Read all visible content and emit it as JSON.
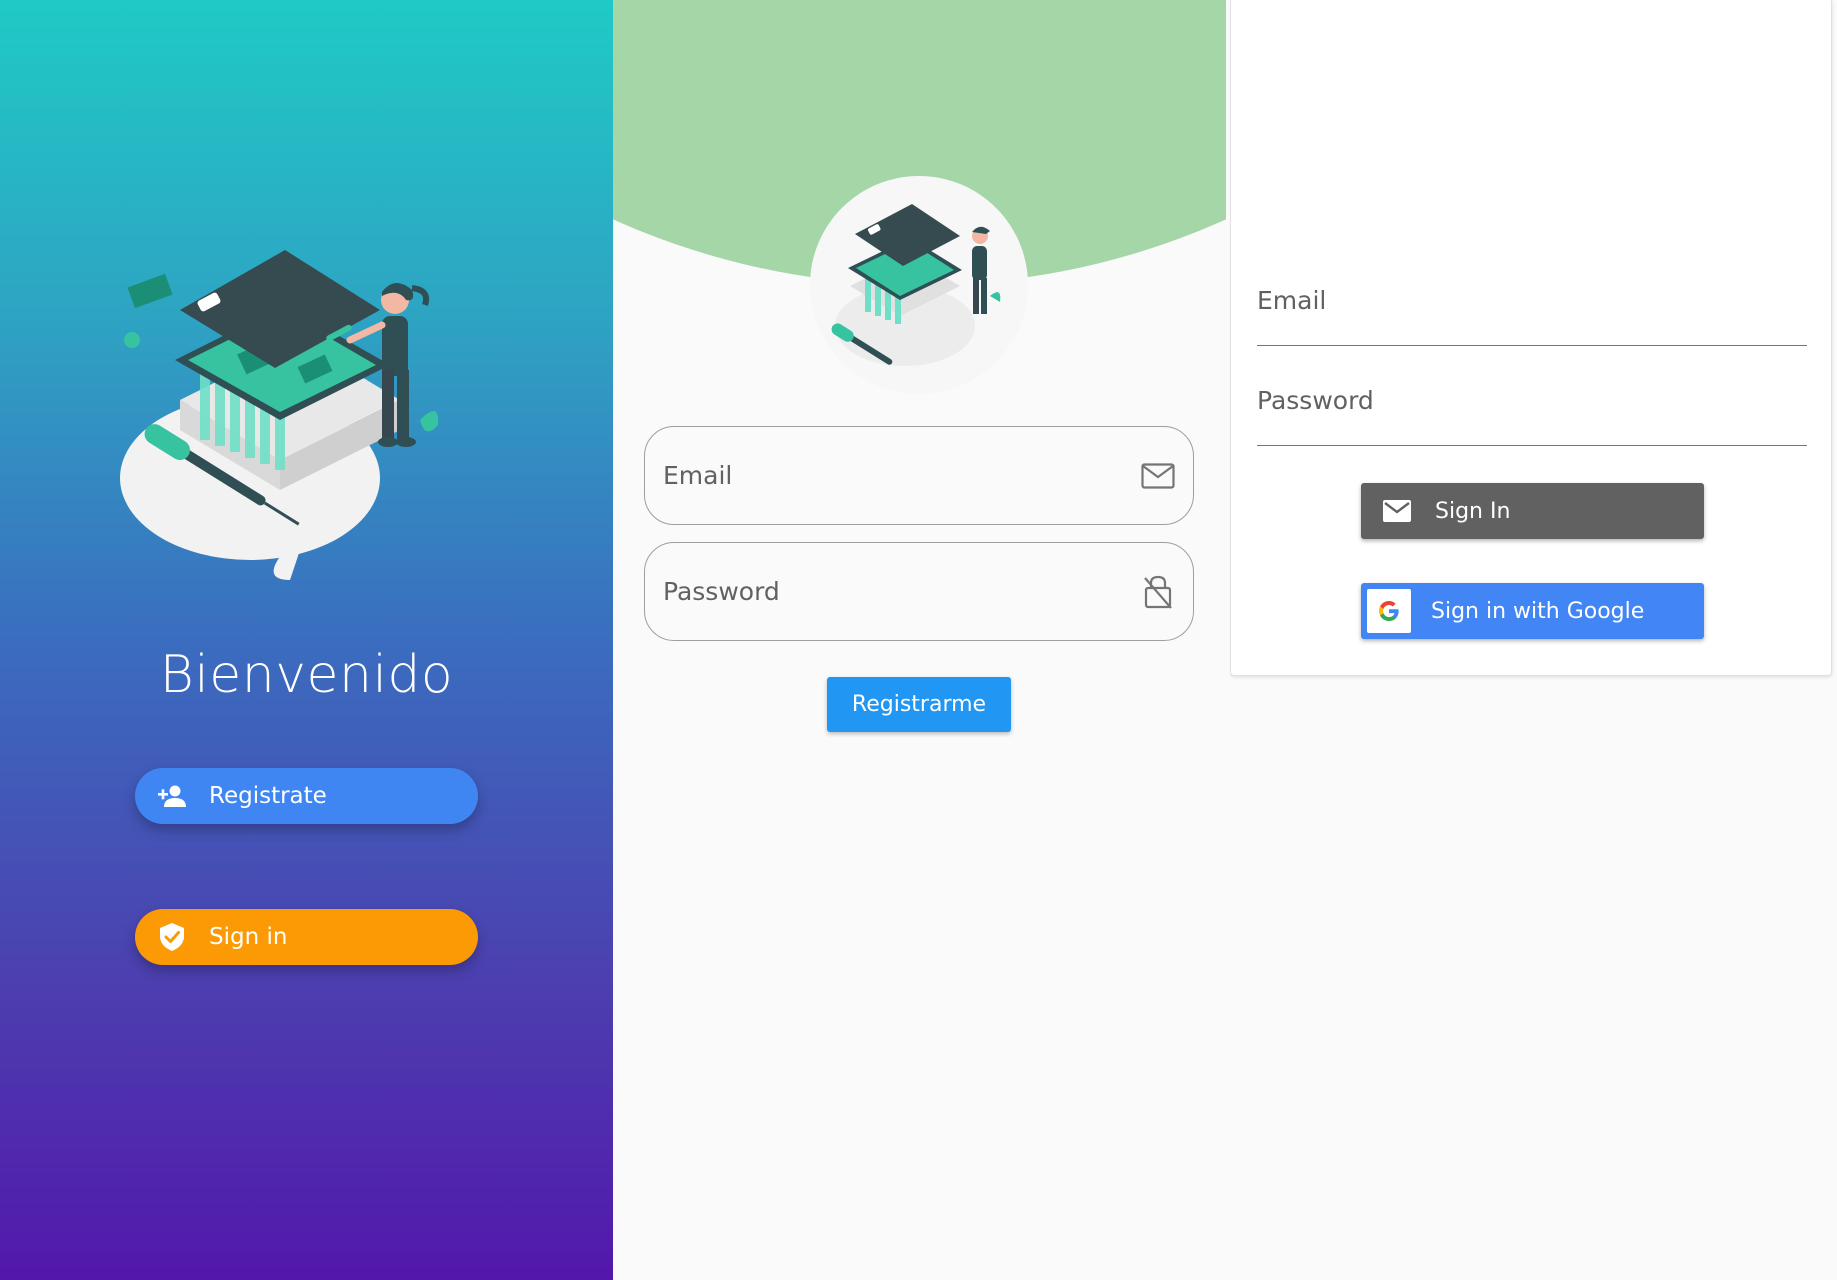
{
  "colors": {
    "welcome_gradient_top": "#1fcac5",
    "welcome_gradient_bottom": "#5317ab",
    "register_pill": "#3f86f2",
    "signin_pill": "#fb9a05",
    "arc_green": "#a5d6a7",
    "primary_blue": "#2196f3",
    "email_button_gray": "#616161",
    "google_blue": "#4285f4"
  },
  "welcome": {
    "title": "Bienvenido",
    "illustration": "phone-repair-illustration",
    "register_button": {
      "label": "Registrate",
      "icon": "person-add-icon"
    },
    "signin_button": {
      "label": "Sign in",
      "icon": "verified-shield-icon"
    }
  },
  "register": {
    "avatar": "phone-repair-illustration",
    "email": {
      "placeholder": "Email",
      "icon": "mail-outline-icon"
    },
    "password": {
      "placeholder": "Password",
      "icon": "lock-open-outline-icon"
    },
    "submit_label": "Registrarme"
  },
  "signin": {
    "email": {
      "placeholder": "Email"
    },
    "password": {
      "placeholder": "Password"
    },
    "email_button": {
      "label": "Sign In",
      "icon": "mail-icon"
    },
    "google_button": {
      "label": "Sign in with Google",
      "icon": "google-logo-icon"
    }
  }
}
